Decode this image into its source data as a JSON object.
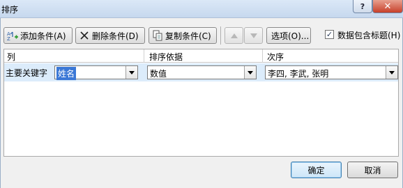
{
  "window": {
    "title": "排序",
    "help_label": "?",
    "close_label": "✕"
  },
  "toolbar": {
    "add_label": "添加条件(A)",
    "delete_label": "删除条件(D)",
    "copy_label": "复制条件(C)",
    "options_label": "选项(O)...",
    "has_headers_label": "数据包含标题(H)",
    "has_headers_checked": true
  },
  "grid": {
    "columns": [
      "列",
      "排序依据",
      "次序"
    ],
    "rows": [
      {
        "label": "主要关键字",
        "column": "姓名",
        "sort_on": "数值",
        "order": "李四, 李武, 张明"
      }
    ]
  },
  "footer": {
    "ok_label": "确定",
    "cancel_label": "取消"
  },
  "colors": {
    "selected_row": "#dcecfb",
    "selection": "#3b78d6",
    "close": "#c7402a"
  }
}
